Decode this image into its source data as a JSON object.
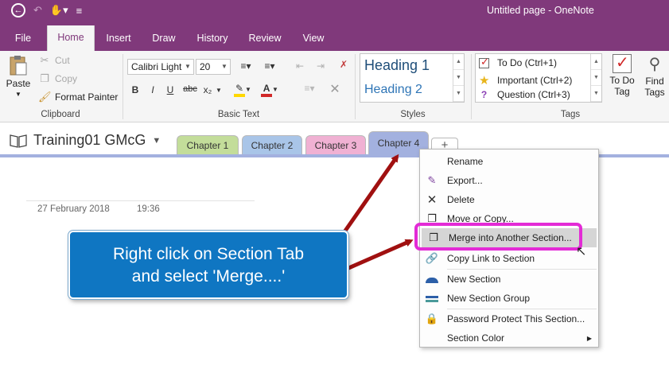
{
  "window": {
    "title": "Untitled page - OneNote"
  },
  "ribbon_tabs": [
    {
      "label": "File"
    },
    {
      "label": "Home"
    },
    {
      "label": "Insert"
    },
    {
      "label": "Draw"
    },
    {
      "label": "History"
    },
    {
      "label": "Review"
    },
    {
      "label": "View"
    }
  ],
  "clipboard": {
    "paste": "Paste",
    "cut": "Cut",
    "copy": "Copy",
    "format_painter": "Format Painter",
    "label": "Clipboard"
  },
  "basic_text": {
    "font": "Calibri Light",
    "size": "20",
    "label": "Basic Text",
    "bold": "B",
    "italic": "I",
    "underline": "U",
    "strike": "abc",
    "subscript": "x₂"
  },
  "styles": {
    "heading1": "Heading 1",
    "heading2": "Heading 2",
    "label": "Styles"
  },
  "tags": {
    "items": [
      {
        "label": "To Do (Ctrl+1)"
      },
      {
        "label": "Important (Ctrl+2)"
      },
      {
        "label": "Question (Ctrl+3)"
      }
    ],
    "todo_tag": "To Do\nTag",
    "find_tags": "Find\nTags",
    "label": "Tags"
  },
  "notebook": {
    "name": "Training01 GMcG"
  },
  "sections": [
    {
      "label": "Chapter 1",
      "color": "#c3dd9a"
    },
    {
      "label": "Chapter 2",
      "color": "#a9c5e8"
    },
    {
      "label": "Chapter 3",
      "color": "#f0b1d3"
    },
    {
      "label": "Chapter 4",
      "color": "#a3b1df"
    }
  ],
  "add_tab": "+",
  "page": {
    "date": "27 February 2018",
    "time": "19:36"
  },
  "callout": {
    "line1": "Right click on Section Tab",
    "line2": "and select 'Merge....'"
  },
  "context_menu": {
    "items": [
      {
        "label": "Rename"
      },
      {
        "label": "Export..."
      },
      {
        "label": "Delete"
      },
      {
        "label": "Move or Copy..."
      },
      {
        "label": "Merge into Another Section..."
      },
      {
        "label": "Copy Link to Section"
      },
      {
        "label": "New Section"
      },
      {
        "label": "New Section Group"
      },
      {
        "label": "Password Protect This Section..."
      },
      {
        "label": "Section Color"
      }
    ]
  }
}
